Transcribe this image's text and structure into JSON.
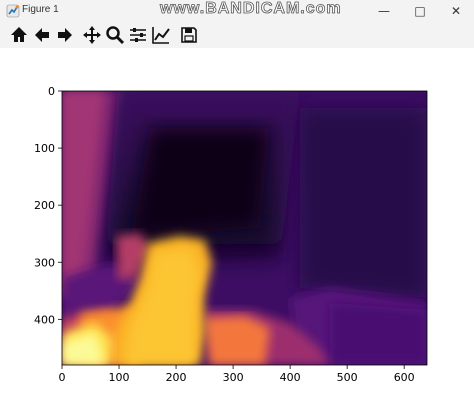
{
  "window": {
    "title": "Figure 1",
    "watermark": "www.BANDICAM.com",
    "controls": [
      "minimize-icon",
      "maximize-icon",
      "close-icon"
    ]
  },
  "toolbar": {
    "buttons": [
      {
        "name": "home-icon"
      },
      {
        "name": "back-arrow-icon"
      },
      {
        "name": "forward-arrow-icon"
      },
      {
        "name": "pan-icon"
      },
      {
        "name": "zoom-icon"
      },
      {
        "name": "configure-subplots-icon"
      },
      {
        "name": "edit-axis-icon"
      },
      {
        "name": "save-icon"
      }
    ]
  },
  "chart_data": {
    "type": "heatmap",
    "colormap": "inferno",
    "xlim": [
      0,
      640
    ],
    "ylim": [
      480,
      0
    ],
    "xticks": [
      "0",
      "100",
      "200",
      "300",
      "400",
      "500",
      "600"
    ],
    "yticks": [
      "0",
      "100",
      "200",
      "300",
      "400"
    ]
  }
}
